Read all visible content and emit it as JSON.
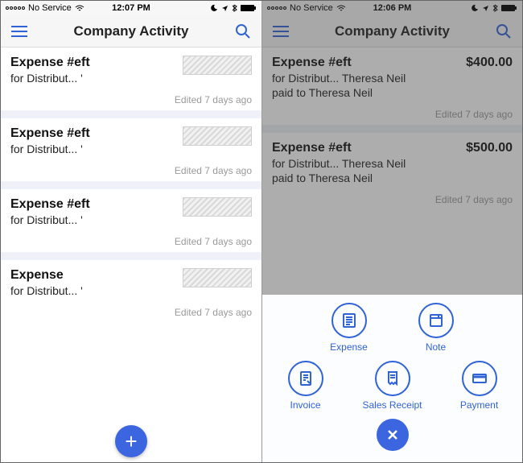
{
  "left": {
    "status": {
      "carrier": "No Service",
      "time": "12:07 PM"
    },
    "title": "Company Activity",
    "items": [
      {
        "title": "Expense #eft",
        "sub": "for Distribut... '",
        "edited": "Edited 7 days ago"
      },
      {
        "title": "Expense #eft",
        "sub": "for Distribut... '",
        "edited": "Edited 7 days ago"
      },
      {
        "title": "Expense #eft",
        "sub": "for Distribut... '",
        "edited": "Edited 7 days ago"
      },
      {
        "title": "Expense",
        "sub": "for Distribut... '",
        "edited": "Edited 7 days ago"
      }
    ]
  },
  "right": {
    "status": {
      "carrier": "No Service",
      "time": "12:06 PM"
    },
    "title": "Company Activity",
    "items": [
      {
        "title": "Expense #eft",
        "sub1": "for Distribut... Theresa Neil",
        "sub2": "paid to Theresa Neil",
        "amount": "$400.00",
        "edited": "Edited 7 days ago"
      },
      {
        "title": "Expense #eft",
        "sub1": "for Distribut... Theresa Neil",
        "sub2": "paid to Theresa Neil",
        "amount": "$500.00",
        "edited": "Edited 7 days ago"
      }
    ],
    "sheet": {
      "row1": [
        {
          "label": "Expense",
          "icon": "expense-icon"
        },
        {
          "label": "Note",
          "icon": "note-icon"
        }
      ],
      "row2": [
        {
          "label": "Invoice",
          "icon": "invoice-icon"
        },
        {
          "label": "Sales Receipt",
          "icon": "receipt-icon"
        },
        {
          "label": "Payment",
          "icon": "payment-icon"
        }
      ]
    }
  }
}
